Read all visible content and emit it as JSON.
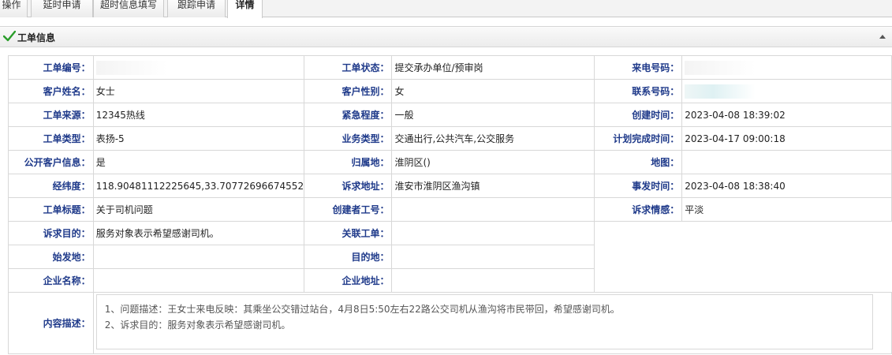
{
  "tabs": [
    {
      "label": "操作"
    },
    {
      "label": "延时申请"
    },
    {
      "label": "超时信息填写"
    },
    {
      "label": "跟踪申请"
    },
    {
      "label": "详情",
      "active": true
    }
  ],
  "panel": {
    "title": "工单信息",
    "icon": "check-icon",
    "accent": "#2a9d2a"
  },
  "fields": {
    "ticket_no": {
      "label": "工单编号：",
      "value": ""
    },
    "ticket_status": {
      "label": "工单状态：",
      "value": "提交承办单位/预审岗"
    },
    "caller_no": {
      "label": "来电号码：",
      "value": ""
    },
    "customer_name": {
      "label": "客户姓名：",
      "value": "女士"
    },
    "customer_gender": {
      "label": "客户性别：",
      "value": "女"
    },
    "contact_no": {
      "label": "联系号码：",
      "value": ""
    },
    "source": {
      "label": "工单来源：",
      "value": "12345热线"
    },
    "urgency": {
      "label": "紧急程度：",
      "value": "一般"
    },
    "created_at": {
      "label": "创建时间：",
      "value": "2023-04-08 18:39:02"
    },
    "ticket_type": {
      "label": "工单类型：",
      "value": "表扬-5"
    },
    "business_type": {
      "label": "业务类型：",
      "value": "交通出行,公共汽车,公交服务"
    },
    "planned_done": {
      "label": "计划完成时间：",
      "value": "2023-04-17 09:00:18"
    },
    "public_info": {
      "label": "公开客户信息：",
      "value": "是"
    },
    "district": {
      "label": "归属地：",
      "value": "淮阴区()"
    },
    "map": {
      "label": "地图：",
      "value": ""
    },
    "lnglat": {
      "label": "经纬度：",
      "value": "118.90481112225645,33.70772696674552"
    },
    "address": {
      "label": "诉求地址：",
      "value": "淮安市淮阴区渔沟镇"
    },
    "incident_time": {
      "label": "事发时间：",
      "value": "2023-04-08 18:38:40"
    },
    "title": {
      "label": "工单标题：",
      "value": "关于司机问题"
    },
    "creator_id": {
      "label": "创建者工号：",
      "value": ""
    },
    "emotion": {
      "label": "诉求情感：",
      "value": "平淡"
    },
    "purpose": {
      "label": "诉求目的：",
      "value": "服务对象表示希望感谢司机。"
    },
    "related": {
      "label": "关联工单：",
      "value": ""
    },
    "origin": {
      "label": "始发地：",
      "value": ""
    },
    "destination": {
      "label": "目的地：",
      "value": ""
    },
    "company_name": {
      "label": "企业名称：",
      "value": ""
    },
    "company_address": {
      "label": "企业地址：",
      "value": ""
    },
    "content": {
      "label": "内容描述：",
      "line1": "1、问题描述：王女士来电反映：其乘坐公交错过站台，4月8日5:50左右22路公交司机从渔沟将市民带回，希望感谢司机。",
      "line2": "2、诉求目的：服务对象表示希望感谢司机。"
    }
  }
}
